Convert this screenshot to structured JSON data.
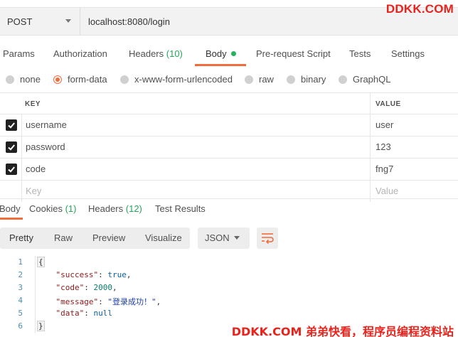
{
  "request": {
    "method": "POST",
    "url": "localhost:8080/login"
  },
  "watermarks": {
    "top": "DDKK.COM",
    "bottom": "DDKK.COM 弟弟快看，程序员编程资料站"
  },
  "request_tabs": [
    {
      "label": "Params"
    },
    {
      "label": "Authorization"
    },
    {
      "label": "Headers",
      "count": "(10)"
    },
    {
      "label": "Body"
    },
    {
      "label": "Pre-request Script"
    },
    {
      "label": "Tests"
    },
    {
      "label": "Settings"
    }
  ],
  "body_types": [
    {
      "label": "none",
      "selected": false
    },
    {
      "label": "form-data",
      "selected": true
    },
    {
      "label": "x-www-form-urlencoded",
      "selected": false
    },
    {
      "label": "raw",
      "selected": false
    },
    {
      "label": "binary",
      "selected": false
    },
    {
      "label": "GraphQL",
      "selected": false
    }
  ],
  "params_table": {
    "header_key": "KEY",
    "header_value": "VALUE",
    "rows": [
      {
        "key": "username",
        "value": "user",
        "checked": true
      },
      {
        "key": "password",
        "value": "123",
        "checked": true
      },
      {
        "key": "code",
        "value": "fng7",
        "checked": true
      }
    ],
    "placeholder_key": "Key",
    "placeholder_value": "Value"
  },
  "response_tabs": [
    {
      "label": "Body"
    },
    {
      "label": "Cookies",
      "count": "(1)"
    },
    {
      "label": "Headers",
      "count": "(12)"
    },
    {
      "label": "Test Results"
    }
  ],
  "view_modes": [
    "Pretty",
    "Raw",
    "Preview",
    "Visualize"
  ],
  "format": "JSON",
  "code_lines": {
    "numbers": [
      "1",
      "2",
      "3",
      "4",
      "5",
      "6"
    ],
    "open": "{",
    "close": "}",
    "success_key": "\"success\"",
    "success_val": "true",
    "code_key": "\"code\"",
    "code_val": "2000",
    "message_key": "\"message\"",
    "message_val": "\"登录成功！\"",
    "data_key": "\"data\"",
    "data_val": "null"
  },
  "colors": {
    "accent": "#f26b3a",
    "count_green": "#26a65b",
    "watermark_red": "#e8231c"
  }
}
